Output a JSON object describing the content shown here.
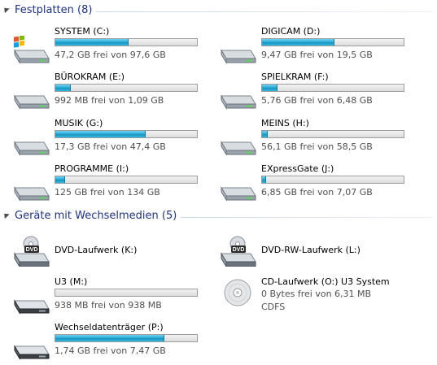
{
  "groups": {
    "hdd": {
      "title": "Festplatten (8)"
    },
    "removable": {
      "title": "Geräte mit Wechselmedien (5)"
    }
  },
  "drives": [
    {
      "name": "SYSTEM (C:)",
      "info": "47,2 GB frei von 97,6 GB",
      "used_fraction": 0.52,
      "icon": "windows-drive-icon"
    },
    {
      "name": "DIGICAM (D:)",
      "info": "9,47 GB frei von 19,5 GB",
      "used_fraction": 0.51,
      "icon": "hard-drive-icon"
    },
    {
      "name": "BÜROKRAM (E:)",
      "info": "992 MB frei von 1,09 GB",
      "used_fraction": 0.11,
      "icon": "hard-drive-icon"
    },
    {
      "name": "SPIELKRAM (F:)",
      "info": "5,76 GB frei von 6,48 GB",
      "used_fraction": 0.11,
      "icon": "hard-drive-icon"
    },
    {
      "name": "MUSIK (G:)",
      "info": "17,3 GB frei von 47,4 GB",
      "used_fraction": 0.64,
      "icon": "hard-drive-icon"
    },
    {
      "name": "MEINS (H:)",
      "info": "56,1 GB frei von 58,5 GB",
      "used_fraction": 0.04,
      "icon": "hard-drive-icon"
    },
    {
      "name": "PROGRAMME (I:)",
      "info": "125 GB frei von 134 GB",
      "used_fraction": 0.07,
      "icon": "hard-drive-icon"
    },
    {
      "name": "EXpressGate (J:)",
      "info": "6,85 GB frei von 7,07 GB",
      "used_fraction": 0.03,
      "icon": "hard-drive-icon"
    }
  ],
  "removable": [
    {
      "name": "DVD-Laufwerk (K:)",
      "icon": "dvd-drive-icon"
    },
    {
      "name": "DVD-RW-Laufwerk (L:)",
      "icon": "dvd-drive-icon"
    },
    {
      "name": "U3 (M:)",
      "info": "938 MB frei von 938 MB",
      "used_fraction": 0.0,
      "icon": "usb-drive-icon"
    },
    {
      "name": "CD-Laufwerk (O:) U3 System",
      "info": "0 Bytes frei von 6,31 MB",
      "info2": "CDFS",
      "icon": "cd-icon"
    },
    {
      "name": "Wechseldatenträger (P:)",
      "info": "1,74 GB frei von 7,47 GB",
      "used_fraction": 0.77,
      "icon": "usb-drive-icon"
    }
  ],
  "colors": {
    "header_text": "#1e3287",
    "bar_fill": "#2cadd8",
    "info_text": "#505050"
  }
}
